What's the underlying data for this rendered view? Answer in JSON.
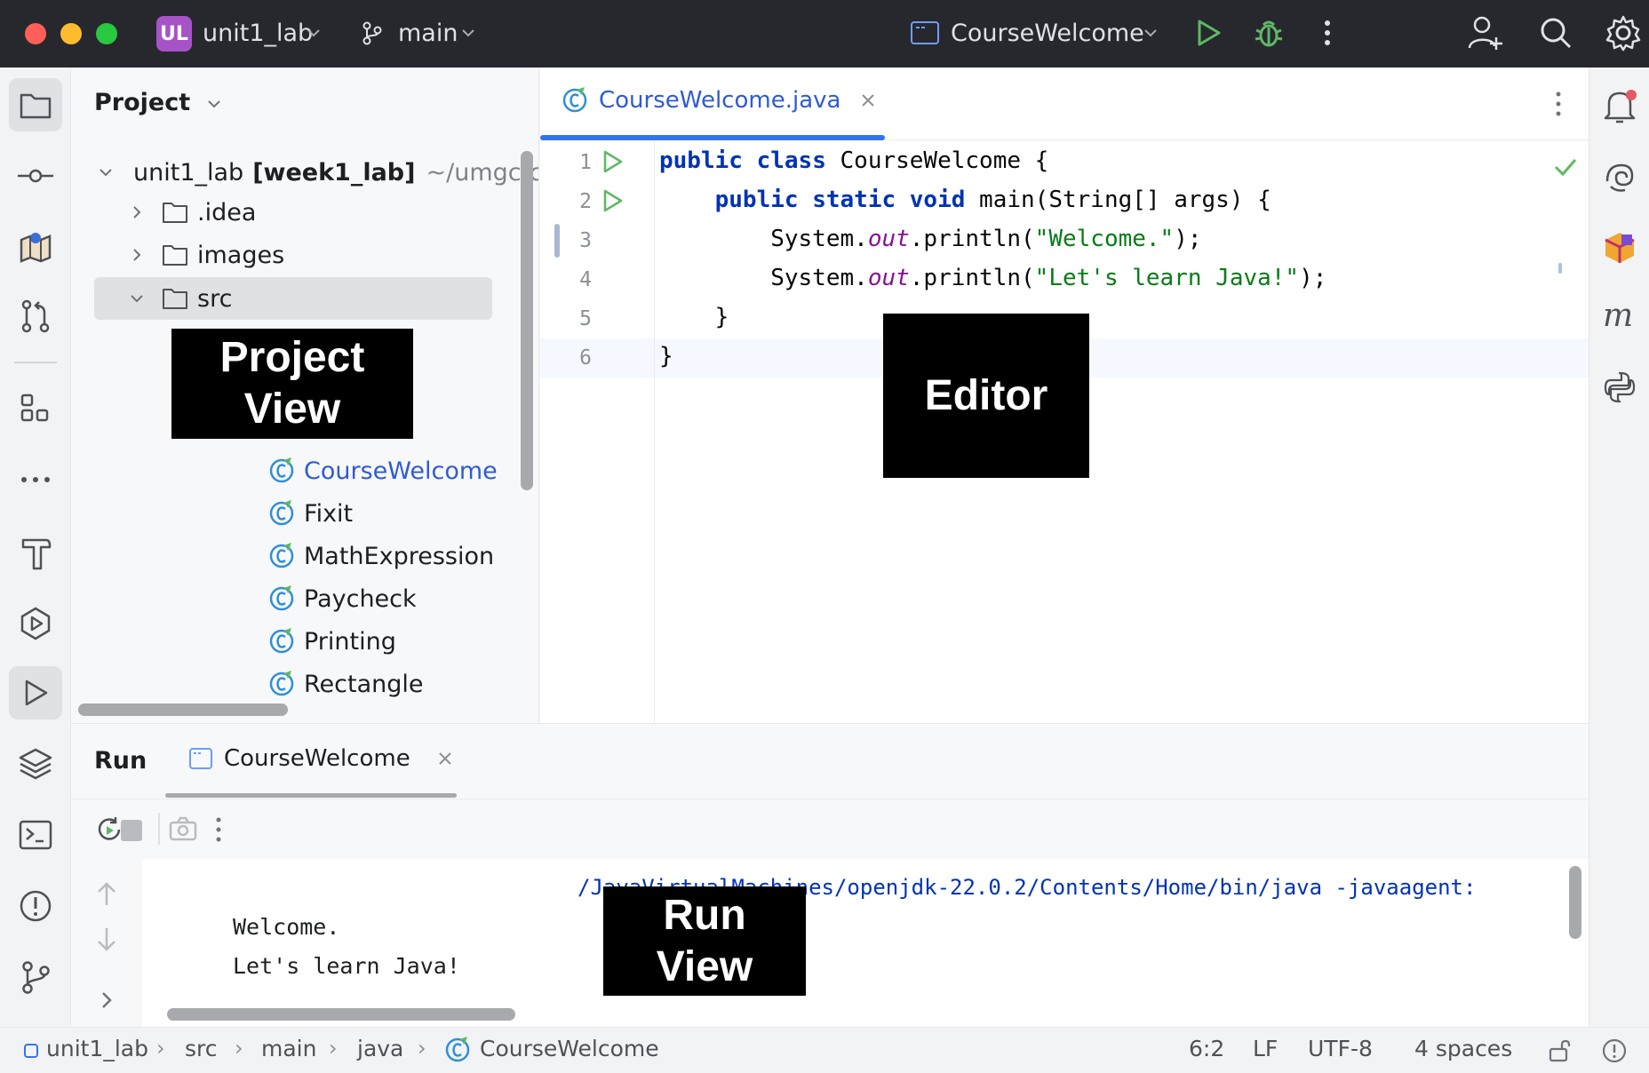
{
  "titlebar": {
    "project_badge": "UL",
    "project_name": "unit1_lab",
    "branch": "main",
    "run_config": "CourseWelcome"
  },
  "project_panel": {
    "title": "Project",
    "root_name": "unit1_lab",
    "root_module": "[week1_lab]",
    "root_path": "~/umgc/c",
    "items": [
      ".idea",
      "images",
      "src"
    ],
    "classes": [
      "CourseWelcome",
      "Fixit",
      "MathExpression",
      "Paycheck",
      "Printing",
      "Rectangle"
    ]
  },
  "editor": {
    "tab_label": "CourseWelcome.java",
    "line_numbers": [
      "1",
      "2",
      "3",
      "4",
      "5",
      "6"
    ],
    "lines": [
      "public class CourseWelcome {",
      "    public static void main(String[] args) {",
      "        System.out.println(\"Welcome.\");",
      "        System.out.println(\"Let's learn Java!\");",
      "    }",
      "}"
    ]
  },
  "run_panel": {
    "title": "Run",
    "tab_label": "CourseWelcome",
    "command": "/JavaVirtualMachines/openjdk-22.0.2/Contents/Home/bin/java -javaagent:",
    "output": [
      "Welcome.",
      "Let's learn Java!"
    ]
  },
  "overlays": {
    "project_view": "Project\nView",
    "editor": "Editor",
    "run_view": "Run\nView"
  },
  "statusbar": {
    "breadcrumb": [
      "unit1_lab",
      "src",
      "main",
      "java",
      "CourseWelcome"
    ],
    "position": "6:2",
    "line_ending": "LF",
    "encoding": "UTF-8",
    "indent": "4 spaces"
  },
  "colors": {
    "titlebar_bg": "#27282e",
    "accent": "#3574f0",
    "run_green": "#4caf50",
    "badge_purple": "#a753c8"
  }
}
